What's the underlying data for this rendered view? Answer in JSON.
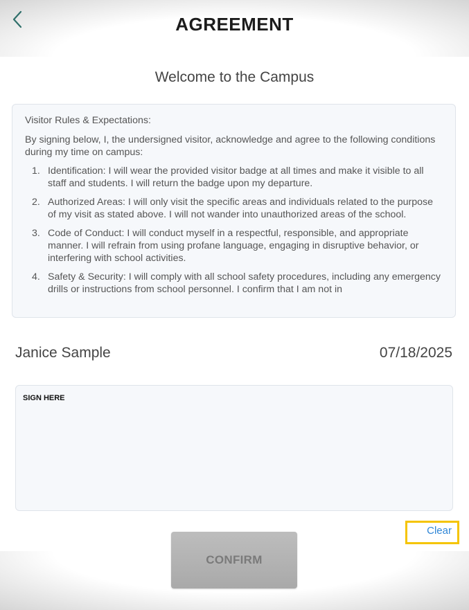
{
  "header": {
    "title": "AGREEMENT",
    "back_icon": "chevron-left-icon"
  },
  "welcome": "Welcome to the Campus",
  "rules": {
    "heading": "Visitor Rules & Expectations:",
    "intro": "By signing below, I, the undersigned visitor, acknowledge and agree to the following conditions during my time on campus:",
    "items": [
      {
        "num": "1.",
        "text": "Identification: I will wear the provided visitor badge at all times and make it visible to all staff and students. I will return the badge upon my departure."
      },
      {
        "num": "2.",
        "text": "Authorized Areas: I will only visit the specific areas and individuals related to the purpose of my visit as stated above. I will not wander into unauthorized areas of the school."
      },
      {
        "num": "3.",
        "text": "Code of Conduct: I will conduct myself in a respectful, responsible, and appropriate manner. I will refrain from using profane language, engaging in disruptive behavior, or interfering with school activities."
      },
      {
        "num": "4.",
        "text": "Safety & Security: I will comply with all school safety procedures, including any emergency drills or instructions from school personnel. I confirm that I am not in"
      }
    ]
  },
  "visitor": {
    "name": "Janice Sample",
    "date": "07/18/2025"
  },
  "signature": {
    "label": "SIGN HERE"
  },
  "actions": {
    "clear_label": "Clear",
    "confirm_label": "CONFIRM"
  },
  "colors": {
    "accent_link": "#2f86d6",
    "highlight": "#f5c400",
    "back_icon": "#2f6f6a"
  }
}
